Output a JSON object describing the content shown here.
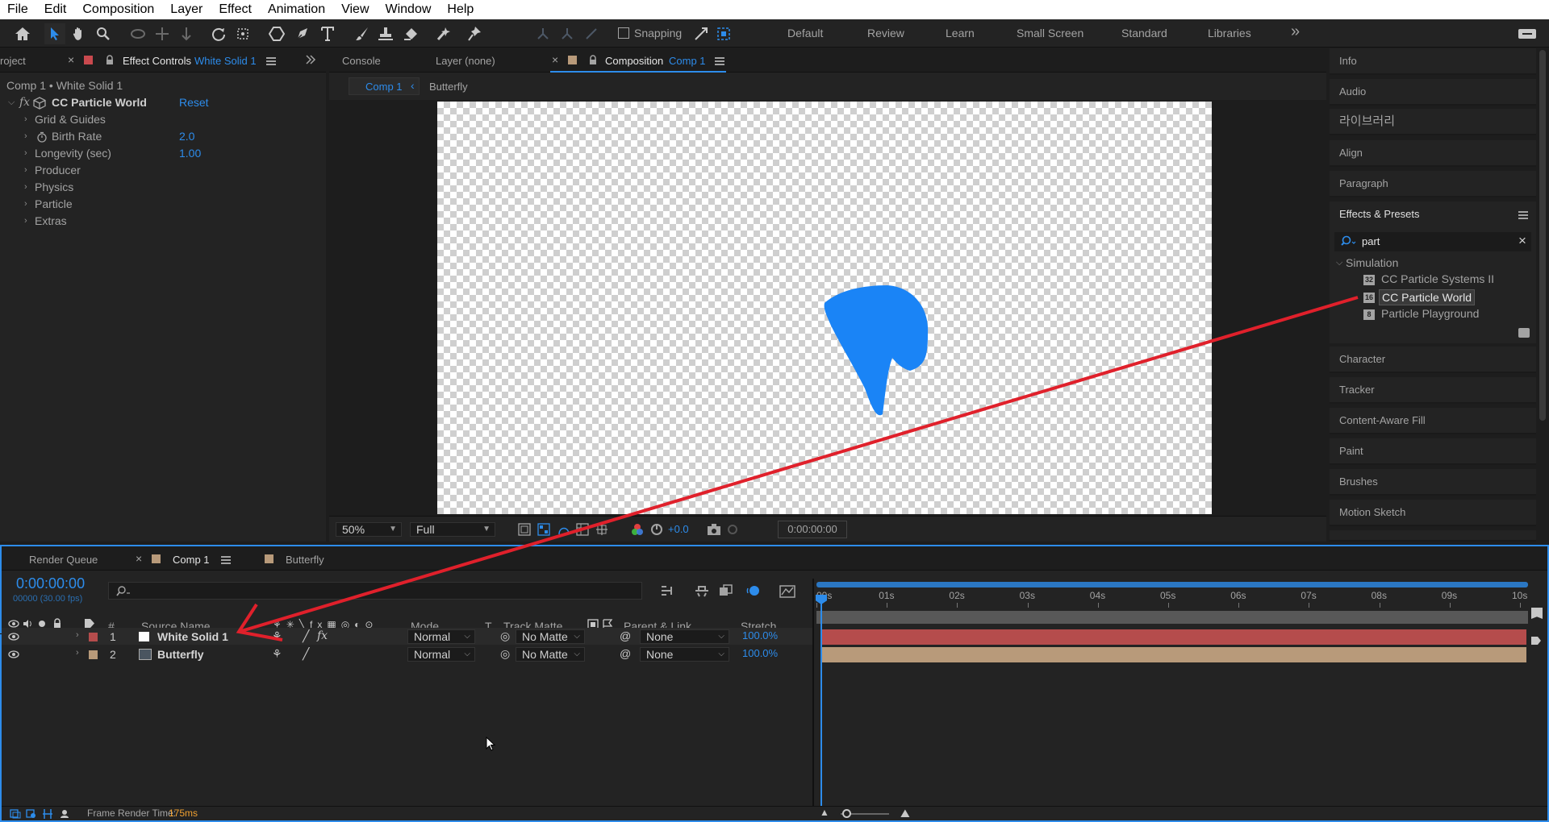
{
  "menu": [
    "File",
    "Edit",
    "Composition",
    "Layer",
    "Effect",
    "Animation",
    "View",
    "Window",
    "Help"
  ],
  "toolbar": {
    "snapping_label": "Snapping",
    "workspaces": [
      "Default",
      "Review",
      "Learn",
      "Small Screen",
      "Standard",
      "Libraries"
    ],
    "more": "»"
  },
  "left_panel": {
    "project_tab": "roject",
    "close": "×",
    "effect_controls_tab": "Effect Controls",
    "effect_controls_layer": "White Solid 1",
    "breadcrumb": "Comp 1 • White Solid 1",
    "fx_label": "fx",
    "effect_name": "CC Particle World",
    "reset_label": "Reset",
    "properties": [
      {
        "name": "Grid & Guides",
        "value": ""
      },
      {
        "name": "Birth Rate",
        "value": "2.0"
      },
      {
        "name": "Longevity (sec)",
        "value": "1.00"
      },
      {
        "name": "Producer",
        "value": ""
      },
      {
        "name": "Physics",
        "value": ""
      },
      {
        "name": "Particle",
        "value": ""
      },
      {
        "name": "Extras",
        "value": ""
      }
    ]
  },
  "viewer": {
    "tabs": {
      "console": "Console",
      "layer": "Layer (none)",
      "composition": "Composition",
      "comp_name": "Comp 1"
    },
    "breadcrumbs": [
      "Comp 1",
      "Butterfly"
    ],
    "zoom": "50%",
    "resolution": "Full",
    "exposure": "+0.0",
    "timecode": "0:00:00:00"
  },
  "right_panels": {
    "top": [
      "Info",
      "Audio",
      "라이브러리",
      "Align",
      "Paragraph"
    ],
    "effects_presets": {
      "title": "Effects & Presets",
      "search_value": "part",
      "category": "Simulation",
      "items": [
        "CC Particle Systems II",
        "CC Particle World",
        "Particle Playground"
      ]
    },
    "bottom": [
      "Character",
      "Tracker",
      "Content-Aware Fill",
      "Paint",
      "Brushes",
      "Motion Sketch"
    ]
  },
  "timeline": {
    "tabs": {
      "render_queue": "Render Queue",
      "comp1": "Comp 1",
      "butterfly": "Butterfly"
    },
    "current_time": "0:00:00:00",
    "frame_info": "00000 (30.00 fps)",
    "columns": {
      "num": "#",
      "source_name": "Source Name",
      "mode": "Mode",
      "t": "T",
      "track_matte": "Track Matte",
      "parent_link": "Parent & Link",
      "stretch": "Stretch"
    },
    "layers": [
      {
        "num": "1",
        "name": "White Solid 1",
        "mode": "Normal",
        "track_matte": "No Matte",
        "parent": "None",
        "stretch": "100.0%",
        "label_color": "#b54c4c"
      },
      {
        "num": "2",
        "name": "Butterfly",
        "mode": "Normal",
        "track_matte": "No Matte",
        "parent": "None",
        "stretch": "100.0%",
        "label_color": "#b89a7a"
      }
    ],
    "ruler": [
      "00s",
      "01s",
      "02s",
      "03s",
      "04s",
      "05s",
      "06s",
      "07s",
      "08s",
      "09s",
      "10s"
    ],
    "render_time_label": "Frame Render Time:",
    "render_time_value": "175ms"
  },
  "colors": {
    "accent": "#2d8ceb",
    "shape_fill": "#1a84f6",
    "annotation": "#e0202b"
  }
}
